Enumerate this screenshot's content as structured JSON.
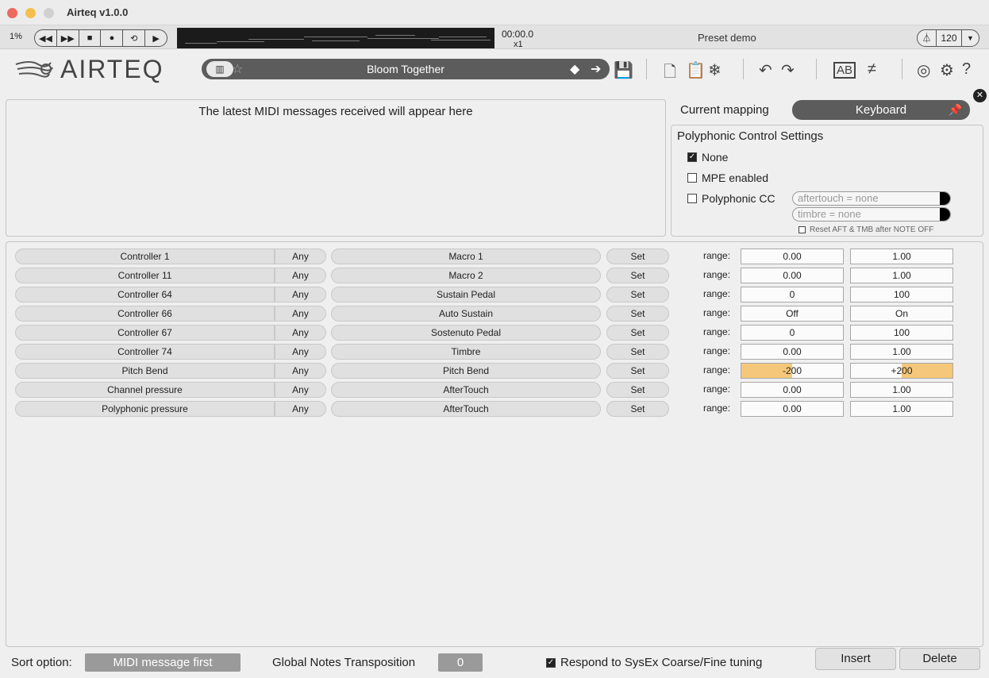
{
  "window": {
    "title": "Airteq v1.0.0"
  },
  "transport": {
    "cpu": "1%",
    "buttons": [
      "◀◀",
      "▶▶",
      "■",
      "●",
      "⟲",
      "▶"
    ],
    "time": "00:00.0",
    "multiplier": "x1",
    "preset_label": "Preset demo",
    "bpm": "120"
  },
  "toolbar": {
    "logo": "AIRTEQ",
    "preset_name": "Bloom Together"
  },
  "midi_log": {
    "message": "The latest MIDI messages received will appear here"
  },
  "mapping": {
    "label": "Current mapping",
    "current": "Keyboard"
  },
  "poly": {
    "title": "Polyphonic Control Settings",
    "none_label": "None",
    "mpe_label": "MPE enabled",
    "cc_label": "Polyphonic CC",
    "aftertouch_placeholder": "aftertouch = none",
    "timbre_placeholder": "timbre = none",
    "reset_label": "Reset AFT & TMB after NOTE OFF"
  },
  "rows": [
    {
      "src": "Controller 1",
      "ch": "Any",
      "dst": "Macro 1",
      "set": "Set",
      "range": "range:",
      "min": "0.00",
      "max": "1.00"
    },
    {
      "src": "Controller 11",
      "ch": "Any",
      "dst": "Macro 2",
      "set": "Set",
      "range": "range:",
      "min": "0.00",
      "max": "1.00"
    },
    {
      "src": "Controller 64",
      "ch": "Any",
      "dst": "Sustain Pedal",
      "set": "Set",
      "range": "range:",
      "min": "0",
      "max": "100"
    },
    {
      "src": "Controller 66",
      "ch": "Any",
      "dst": "Auto Sustain",
      "set": "Set",
      "range": "range:",
      "min": "Off",
      "max": "On"
    },
    {
      "src": "Controller 67",
      "ch": "Any",
      "dst": "Sostenuto Pedal",
      "set": "Set",
      "range": "range:",
      "min": "0",
      "max": "100"
    },
    {
      "src": "Controller 74",
      "ch": "Any",
      "dst": "Timbre",
      "set": "Set",
      "range": "range:",
      "min": "0.00",
      "max": "1.00"
    },
    {
      "src": "Pitch Bend",
      "ch": "Any",
      "dst": "Pitch Bend",
      "set": "Set",
      "range": "range:",
      "min": "-200",
      "max": "+200"
    },
    {
      "src": "Channel pressure",
      "ch": "Any",
      "dst": "AfterTouch",
      "set": "Set",
      "range": "range:",
      "min": "0.00",
      "max": "1.00"
    },
    {
      "src": "Polyphonic pressure",
      "ch": "Any",
      "dst": "AfterTouch",
      "set": "Set",
      "range": "range:",
      "min": "0.00",
      "max": "1.00"
    }
  ],
  "bottom": {
    "sort_label": "Sort option:",
    "sort_value": "MIDI message first",
    "transpose_label": "Global Notes Transposition",
    "transpose_value": "0",
    "sysex_label": "Respond to SysEx Coarse/Fine tuning",
    "insert": "Insert",
    "delete": "Delete"
  },
  "colors": {
    "highlight": "#f4c77a",
    "dark_pill": "#5c5c5c"
  }
}
